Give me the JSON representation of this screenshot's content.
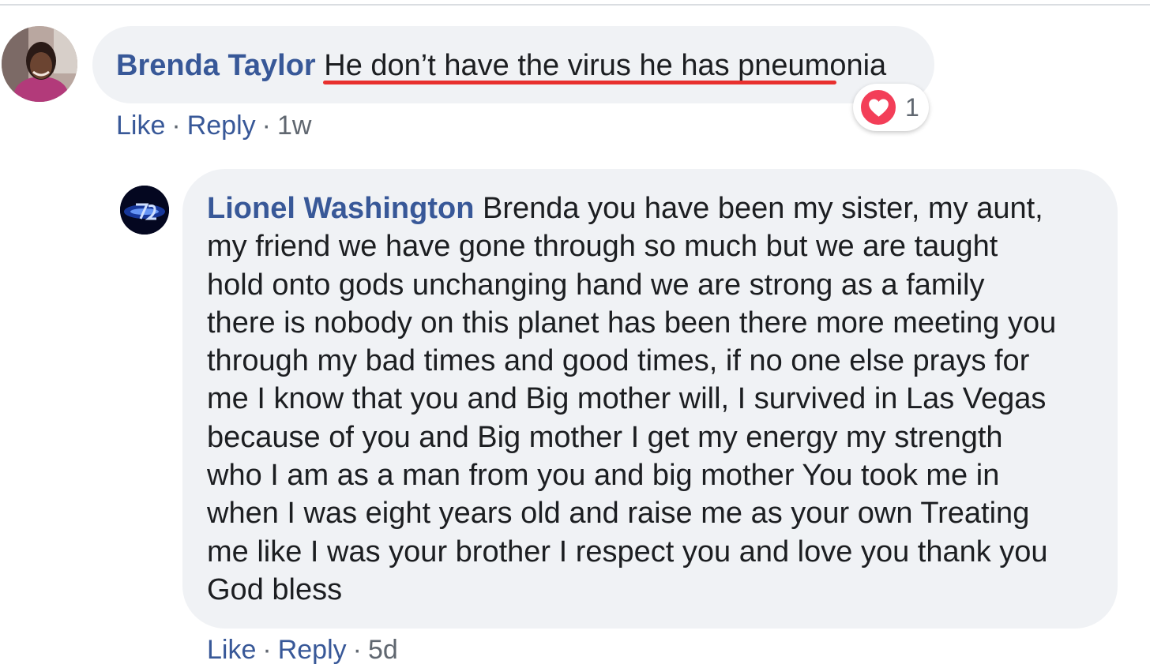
{
  "comments": [
    {
      "author": "Brenda Taylor",
      "text": "He don’t have the virus he has pneumonia",
      "reaction": {
        "icon": "heart-icon",
        "count": "1",
        "color": "#f33e58"
      },
      "actions": {
        "like": "Like",
        "reply": "Reply",
        "separator": "·",
        "time": "1w"
      }
    },
    {
      "author": "Lionel Washington",
      "lines": [
        "Brenda you have been my sister, my aunt,",
        "my friend we have gone through so much but we are taught",
        "hold onto gods unchanging hand we are strong as a family",
        "there is nobody on this planet has been there more meeting you",
        "through my bad times and good times, if no one else prays for",
        "me I know that you and Big mother will, I survived in Las Vegas",
        "because of you and Big mother I get my energy my strength",
        "who I am as a man from you and big mother You took me in",
        "when I was eight years old and raise me as your own Treating",
        "me like I was your brother I respect you and love you thank you",
        "God bless"
      ],
      "actions": {
        "like": "Like",
        "reply": "Reply",
        "separator": "·",
        "time": "5d"
      }
    }
  ],
  "colors": {
    "author": "#385898",
    "bubble": "#f0f2f5",
    "underline": "#e8302e"
  }
}
